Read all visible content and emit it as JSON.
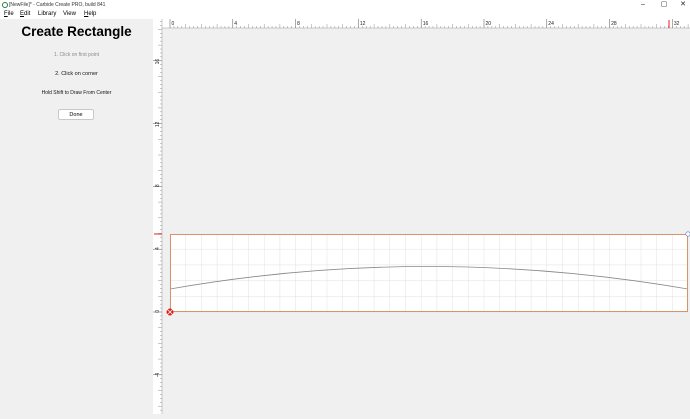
{
  "window": {
    "title": "[NewFile]* - Carbide Create PRO, build 841",
    "minimize": "–",
    "maximize": "▢",
    "close": "✕",
    "icon": "carbide-logo-icon"
  },
  "menu": [
    {
      "label": "File",
      "underline": "F",
      "rest": "ile"
    },
    {
      "label": "Edit",
      "underline": "E",
      "rest": "dit"
    },
    {
      "label": "Library",
      "underline": "",
      "rest": "Library"
    },
    {
      "label": "View",
      "underline": "",
      "rest": "View"
    },
    {
      "label": "Help",
      "underline": "H",
      "rest": "elp"
    }
  ],
  "panel": {
    "title": "Create Rectangle",
    "step1": "1. Click on first point",
    "step2": "2. Click on corner",
    "shift_hint": "Hold Shift to Draw From Center",
    "done_label": "Done"
  },
  "rulers": {
    "horizontal_labels": [
      "0",
      "4",
      "8",
      "12",
      "16",
      "20",
      "24",
      "28",
      "32"
    ],
    "vertical_labels": [
      "16",
      "12",
      "8",
      "4",
      "0",
      "-4"
    ]
  },
  "colors": {
    "rectangle_outline": "#d4956a",
    "grid": "#e2e2e2",
    "curve": "#888888",
    "cursor_marker": "#e02020"
  }
}
